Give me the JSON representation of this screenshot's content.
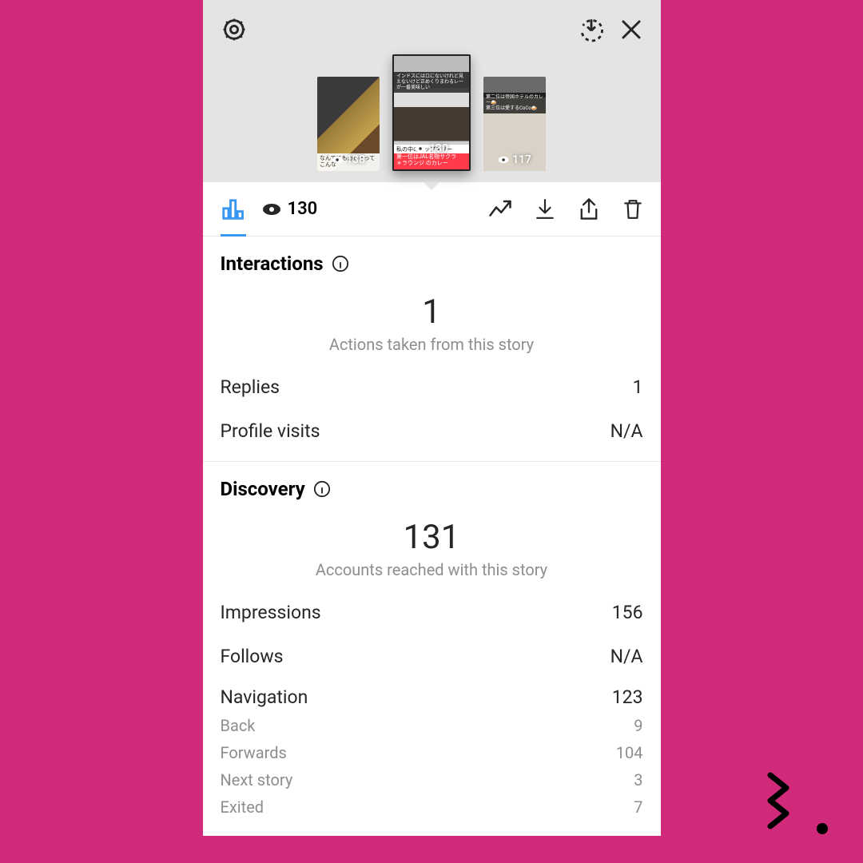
{
  "header": {
    "thumbs": [
      {
        "views": "138",
        "caption": "なんでにもカレーってこんな"
      },
      {
        "views": "130",
        "top_text": "インドスにはロにないけれど見えないけど正めくりまわるレーが一番美味しい",
        "caption_white": "私の中のトップスリー",
        "caption_red1": "第一位はJAL名物サクラ",
        "caption_red2": "＊ラウンジ のカレー"
      },
      {
        "views": "117",
        "top_line1": "第二位は帝国ホテルのカレー🍛",
        "top_line2": "第三位は愛するCoCo🍛"
      }
    ]
  },
  "tabbar": {
    "views_label": "130"
  },
  "interactions": {
    "title": "Interactions",
    "number": "1",
    "caption": "Actions taken from this story",
    "rows": [
      {
        "label": "Replies",
        "value": "1"
      },
      {
        "label": "Profile visits",
        "value": "N/A"
      }
    ]
  },
  "discovery": {
    "title": "Discovery",
    "number": "131",
    "caption": "Accounts reached with this story",
    "rows": [
      {
        "label": "Impressions",
        "value": "156"
      },
      {
        "label": "Follows",
        "value": "N/A"
      },
      {
        "label": "Navigation",
        "value": "123"
      }
    ],
    "subrows": [
      {
        "label": "Back",
        "value": "9"
      },
      {
        "label": "Forwards",
        "value": "104"
      },
      {
        "label": "Next story",
        "value": "3"
      },
      {
        "label": "Exited",
        "value": "7"
      }
    ]
  }
}
